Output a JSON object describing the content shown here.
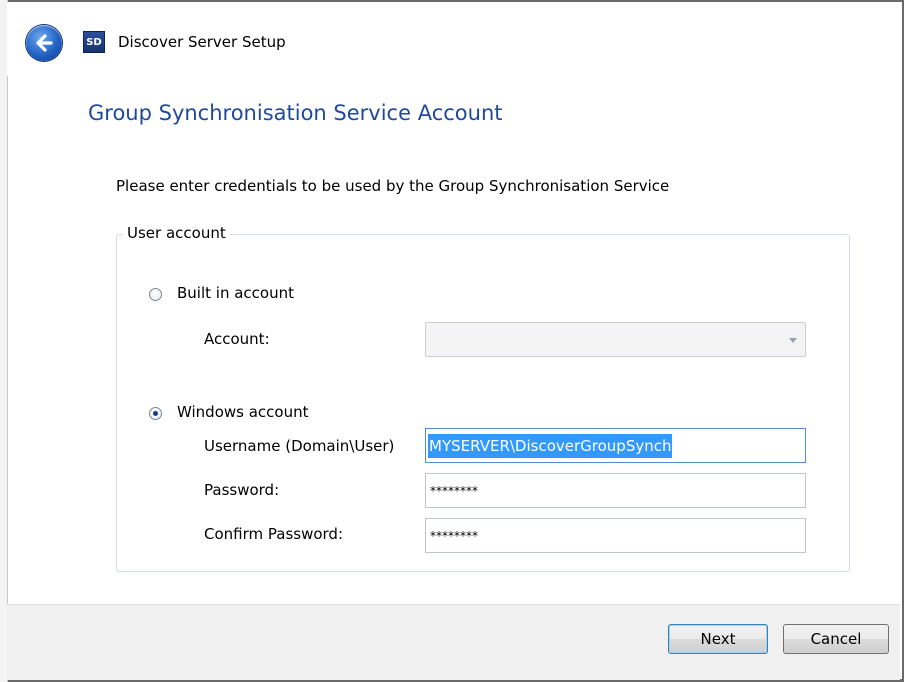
{
  "window": {
    "title": "Discover Server Setup",
    "app_icon_text": "SD"
  },
  "page": {
    "title": "Group Synchronisation Service Account",
    "instructions": "Please enter credentials to be used by the Group Synchronisation Service"
  },
  "user_account": {
    "legend": "User account",
    "built_in": {
      "label": "Built in account",
      "selected": false,
      "account_label": "Account:",
      "account_value": ""
    },
    "windows": {
      "label": "Windows account",
      "selected": true,
      "username_label": "Username (Domain\\User)",
      "username_value": "MYSERVER\\DiscoverGroupSynch",
      "password_label": "Password:",
      "password_value": "********",
      "confirm_label": "Confirm Password:",
      "confirm_value": "********"
    }
  },
  "buttons": {
    "next": "Next",
    "cancel": "Cancel"
  },
  "colors": {
    "title": "#1f4a9c",
    "selection": "#3399ff",
    "focus_border": "#4f8fd6"
  }
}
